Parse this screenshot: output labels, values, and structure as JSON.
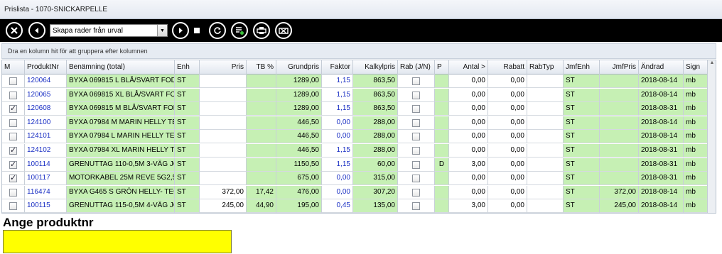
{
  "window": {
    "title": "Prislista - 1070-SNICKARPELLE"
  },
  "toolbar": {
    "close_icon": "close-circle-icon",
    "back_icon": "back-arrow-icon",
    "action_select": "Skapa rader från urval",
    "play_icon": "play-icon",
    "stop_icon": "stop-icon",
    "refresh_icon": "refresh-icon",
    "list_icon": "list-settings-icon",
    "print_icon": "print-icon",
    "clear_icon": "eraser-icon"
  },
  "grouping_hint": "Dra en kolumn hit för att gruppera efter kolumnen",
  "columns": [
    "M",
    "ProduktNr",
    "Benämning (total)",
    "Enh",
    "Pris",
    "TB %",
    "Grundpris",
    "Faktor",
    "Kalkylpris",
    "Rab (J/N)",
    "P",
    "Antal >",
    "Rabatt",
    "RabTyp",
    "JmfEnh",
    "JmfPris",
    "Ändrad",
    "Sign"
  ],
  "rows": [
    {
      "m": false,
      "nr": "120064",
      "name": "BYXA 069815 L BLÅ/SVART FODRAD",
      "enh": "ST",
      "pris": "",
      "tb": "",
      "grund": "1289,00",
      "faktor": "1,15",
      "kalkyl": "863,50",
      "rab": false,
      "p": "",
      "antal": "0,00",
      "rabatt": "0,00",
      "rabtyp": "",
      "jmfenh": "ST",
      "jmfpris": "",
      "andrad": "2018-08-14",
      "sign": "mb"
    },
    {
      "m": false,
      "nr": "120065",
      "name": "BYXA 069815 XL BLÅ/SVART FODRAD",
      "enh": "ST",
      "pris": "",
      "tb": "",
      "grund": "1289,00",
      "faktor": "1,15",
      "kalkyl": "863,50",
      "rab": false,
      "p": "",
      "antal": "0,00",
      "rabatt": "0,00",
      "rabtyp": "",
      "jmfenh": "ST",
      "jmfpris": "",
      "andrad": "2018-08-14",
      "sign": "mb"
    },
    {
      "m": true,
      "nr": "120608",
      "name": "BYXA 069815 M BLÅ/SVART FODRAD",
      "enh": "ST",
      "pris": "",
      "tb": "",
      "grund": "1289,00",
      "faktor": "1,15",
      "kalkyl": "863,50",
      "rab": false,
      "p": "",
      "antal": "0,00",
      "rabatt": "0,00",
      "rabtyp": "",
      "jmfenh": "ST",
      "jmfpris": "",
      "andrad": "2018-08-31",
      "sign": "mb"
    },
    {
      "m": false,
      "nr": "124100",
      "name": "BYXA 07984 M MARIN HELLY TECH",
      "enh": "ST",
      "pris": "",
      "tb": "",
      "grund": "446,50",
      "faktor": "0,00",
      "kalkyl": "288,00",
      "rab": false,
      "p": "",
      "antal": "0,00",
      "rabatt": "0,00",
      "rabtyp": "",
      "jmfenh": "ST",
      "jmfpris": "",
      "andrad": "2018-08-14",
      "sign": "mb"
    },
    {
      "m": false,
      "nr": "124101",
      "name": "BYXA 07984 L MARIN HELLY TECH",
      "enh": "ST",
      "pris": "",
      "tb": "",
      "grund": "446,50",
      "faktor": "0,00",
      "kalkyl": "288,00",
      "rab": false,
      "p": "",
      "antal": "0,00",
      "rabatt": "0,00",
      "rabtyp": "",
      "jmfenh": "ST",
      "jmfpris": "",
      "andrad": "2018-08-14",
      "sign": "mb"
    },
    {
      "m": true,
      "nr": "124102",
      "name": "BYXA 07984 XL MARIN HELLY TECH",
      "enh": "ST",
      "pris": "",
      "tb": "",
      "grund": "446,50",
      "faktor": "1,15",
      "kalkyl": "288,00",
      "rab": false,
      "p": "",
      "antal": "0,00",
      "rabatt": "0,00",
      "rabtyp": "",
      "jmfenh": "ST",
      "jmfpris": "",
      "andrad": "2018-08-31",
      "sign": "mb"
    },
    {
      "m": true,
      "nr": "100114",
      "name": "GRENUTTAG 110-0,5M 3-VÄG JORD",
      "enh": "ST",
      "pris": "",
      "tb": "",
      "grund": "1150,50",
      "faktor": "1,15",
      "kalkyl": "60,00",
      "rab": false,
      "p": "D",
      "antal": "3,00",
      "rabatt": "0,00",
      "rabtyp": "",
      "jmfenh": "ST",
      "jmfpris": "",
      "andrad": "2018-08-31",
      "sign": "mb"
    },
    {
      "m": true,
      "nr": "100117",
      "name": "MOTORKABEL 25M REVE 5G2,5 16A",
      "enh": "ST",
      "pris": "",
      "tb": "",
      "grund": "675,00",
      "faktor": "0,00",
      "kalkyl": "315,00",
      "rab": false,
      "p": "",
      "antal": "0,00",
      "rabatt": "0,00",
      "rabtyp": "",
      "jmfenh": "ST",
      "jmfpris": "",
      "andrad": "2018-08-31",
      "sign": "mb"
    },
    {
      "m": false,
      "nr": "116474",
      "name": "BYXA G465 S GRÖN HELLY- TECH",
      "enh": "ST",
      "pris": "372,00",
      "tb": "17,42",
      "grund": "476,00",
      "faktor": "0,00",
      "kalkyl": "307,20",
      "rab": false,
      "p": "",
      "antal": "0,00",
      "rabatt": "0,00",
      "rabtyp": "",
      "jmfenh": "ST",
      "jmfpris": "372,00",
      "andrad": "2018-08-14",
      "sign": "mb"
    },
    {
      "m": false,
      "nr": "100115",
      "name": "GRENUTTAG 115-0,5M 4-VÄG JORD",
      "enh": "ST",
      "pris": "245,00",
      "tb": "44,90",
      "grund": "195,00",
      "faktor": "0,45",
      "kalkyl": "135,00",
      "rab": false,
      "p": "",
      "antal": "3,00",
      "rabatt": "0,00",
      "rabtyp": "",
      "jmfenh": "ST",
      "jmfpris": "245,00",
      "andrad": "2018-08-14",
      "sign": "mb"
    }
  ],
  "prompt": {
    "label": "Ange produktnr",
    "value": ""
  },
  "colors": {
    "green": "#c6f0b4",
    "link_blue": "#1a2fc4",
    "yellow": "#ffff00",
    "toolbar": "#000000"
  }
}
